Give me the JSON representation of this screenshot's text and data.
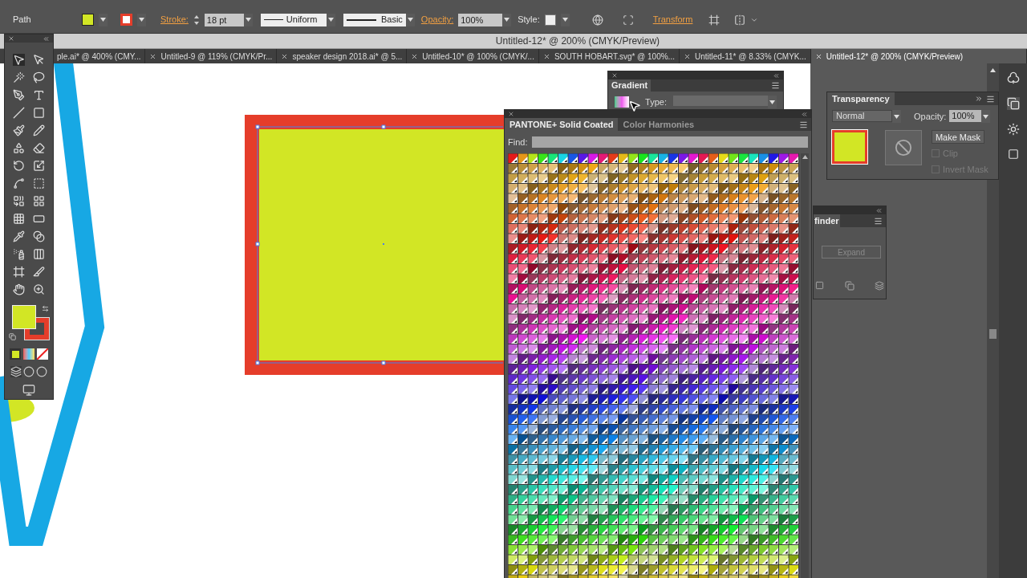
{
  "control_bar": {
    "selection_label": "Path",
    "stroke_label": "Stroke:",
    "stroke_weight": "18 pt",
    "profile": "Uniform",
    "brush": "Basic",
    "opacity_label": "Opacity:",
    "opacity": "100%",
    "style_label": "Style:",
    "transform_link": "Transform"
  },
  "document_title": "Untitled-12* @ 200% (CMYK/Preview)",
  "tabs": [
    {
      "label": "ple.ai* @ 400% (CMY...",
      "selected": false
    },
    {
      "label": "Untitled-9 @ 119% (CMYK/Pr...",
      "selected": false
    },
    {
      "label": "speaker design 2018.ai* @ 5...",
      "selected": false
    },
    {
      "label": "Untitled-10* @ 100% (CMYK/...",
      "selected": false
    },
    {
      "label": "SOUTH HOBART.svg* @ 100%...",
      "selected": false
    },
    {
      "label": "Untitled-11* @ 8.33% (CMYK...",
      "selected": false
    },
    {
      "label": "Untitled-12* @ 200% (CMYK/Preview)",
      "selected": true
    }
  ],
  "gradient_panel": {
    "title": "Gradient",
    "type_label": "Type:"
  },
  "swatch_panel": {
    "tabs": [
      {
        "label": "PANTONE+ Solid Coated",
        "selected": true
      },
      {
        "label": "Color Harmonies",
        "selected": false
      }
    ],
    "find_label": "Find:"
  },
  "transparency_panel": {
    "title": "Transparency",
    "blend_mode": "Normal",
    "opacity_label": "Opacity:",
    "opacity": "100%",
    "make_mask": "Make Mask",
    "options": [
      {
        "label": "Clip",
        "checked": false,
        "disabled": true
      },
      {
        "label": "Invert Mask",
        "checked": false,
        "disabled": true
      }
    ]
  },
  "pathfinder_panel": {
    "title": "finder",
    "expand": {
      "label": "Expand",
      "disabled": true
    }
  }
}
